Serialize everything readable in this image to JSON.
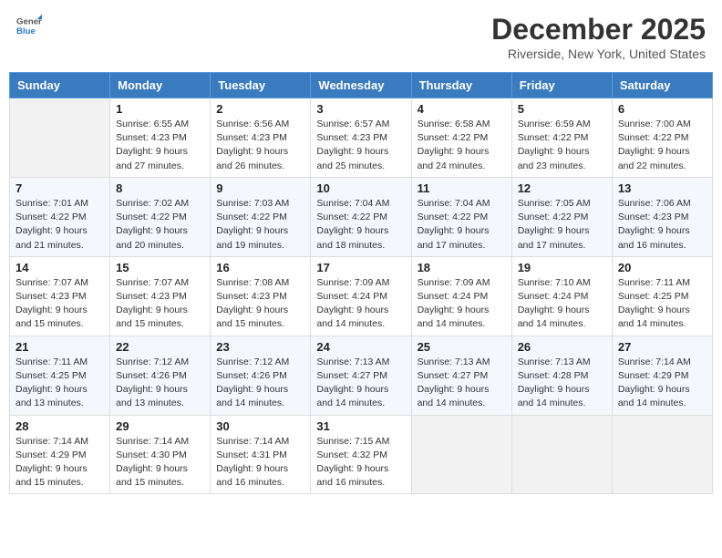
{
  "header": {
    "logo_general": "General",
    "logo_blue": "Blue",
    "month_title": "December 2025",
    "location": "Riverside, New York, United States"
  },
  "days_of_week": [
    "Sunday",
    "Monday",
    "Tuesday",
    "Wednesday",
    "Thursday",
    "Friday",
    "Saturday"
  ],
  "weeks": [
    [
      {
        "num": "",
        "empty": true
      },
      {
        "num": "1",
        "sunrise": "6:55 AM",
        "sunset": "4:23 PM",
        "daylight": "9 hours and 27 minutes."
      },
      {
        "num": "2",
        "sunrise": "6:56 AM",
        "sunset": "4:23 PM",
        "daylight": "9 hours and 26 minutes."
      },
      {
        "num": "3",
        "sunrise": "6:57 AM",
        "sunset": "4:23 PM",
        "daylight": "9 hours and 25 minutes."
      },
      {
        "num": "4",
        "sunrise": "6:58 AM",
        "sunset": "4:22 PM",
        "daylight": "9 hours and 24 minutes."
      },
      {
        "num": "5",
        "sunrise": "6:59 AM",
        "sunset": "4:22 PM",
        "daylight": "9 hours and 23 minutes."
      },
      {
        "num": "6",
        "sunrise": "7:00 AM",
        "sunset": "4:22 PM",
        "daylight": "9 hours and 22 minutes."
      }
    ],
    [
      {
        "num": "7",
        "sunrise": "7:01 AM",
        "sunset": "4:22 PM",
        "daylight": "9 hours and 21 minutes."
      },
      {
        "num": "8",
        "sunrise": "7:02 AM",
        "sunset": "4:22 PM",
        "daylight": "9 hours and 20 minutes."
      },
      {
        "num": "9",
        "sunrise": "7:03 AM",
        "sunset": "4:22 PM",
        "daylight": "9 hours and 19 minutes."
      },
      {
        "num": "10",
        "sunrise": "7:04 AM",
        "sunset": "4:22 PM",
        "daylight": "9 hours and 18 minutes."
      },
      {
        "num": "11",
        "sunrise": "7:04 AM",
        "sunset": "4:22 PM",
        "daylight": "9 hours and 17 minutes."
      },
      {
        "num": "12",
        "sunrise": "7:05 AM",
        "sunset": "4:22 PM",
        "daylight": "9 hours and 17 minutes."
      },
      {
        "num": "13",
        "sunrise": "7:06 AM",
        "sunset": "4:23 PM",
        "daylight": "9 hours and 16 minutes."
      }
    ],
    [
      {
        "num": "14",
        "sunrise": "7:07 AM",
        "sunset": "4:23 PM",
        "daylight": "9 hours and 15 minutes."
      },
      {
        "num": "15",
        "sunrise": "7:07 AM",
        "sunset": "4:23 PM",
        "daylight": "9 hours and 15 minutes."
      },
      {
        "num": "16",
        "sunrise": "7:08 AM",
        "sunset": "4:23 PM",
        "daylight": "9 hours and 15 minutes."
      },
      {
        "num": "17",
        "sunrise": "7:09 AM",
        "sunset": "4:24 PM",
        "daylight": "9 hours and 14 minutes."
      },
      {
        "num": "18",
        "sunrise": "7:09 AM",
        "sunset": "4:24 PM",
        "daylight": "9 hours and 14 minutes."
      },
      {
        "num": "19",
        "sunrise": "7:10 AM",
        "sunset": "4:24 PM",
        "daylight": "9 hours and 14 minutes."
      },
      {
        "num": "20",
        "sunrise": "7:11 AM",
        "sunset": "4:25 PM",
        "daylight": "9 hours and 14 minutes."
      }
    ],
    [
      {
        "num": "21",
        "sunrise": "7:11 AM",
        "sunset": "4:25 PM",
        "daylight": "9 hours and 13 minutes."
      },
      {
        "num": "22",
        "sunrise": "7:12 AM",
        "sunset": "4:26 PM",
        "daylight": "9 hours and 13 minutes."
      },
      {
        "num": "23",
        "sunrise": "7:12 AM",
        "sunset": "4:26 PM",
        "daylight": "9 hours and 14 minutes."
      },
      {
        "num": "24",
        "sunrise": "7:13 AM",
        "sunset": "4:27 PM",
        "daylight": "9 hours and 14 minutes."
      },
      {
        "num": "25",
        "sunrise": "7:13 AM",
        "sunset": "4:27 PM",
        "daylight": "9 hours and 14 minutes."
      },
      {
        "num": "26",
        "sunrise": "7:13 AM",
        "sunset": "4:28 PM",
        "daylight": "9 hours and 14 minutes."
      },
      {
        "num": "27",
        "sunrise": "7:14 AM",
        "sunset": "4:29 PM",
        "daylight": "9 hours and 14 minutes."
      }
    ],
    [
      {
        "num": "28",
        "sunrise": "7:14 AM",
        "sunset": "4:29 PM",
        "daylight": "9 hours and 15 minutes."
      },
      {
        "num": "29",
        "sunrise": "7:14 AM",
        "sunset": "4:30 PM",
        "daylight": "9 hours and 15 minutes."
      },
      {
        "num": "30",
        "sunrise": "7:14 AM",
        "sunset": "4:31 PM",
        "daylight": "9 hours and 16 minutes."
      },
      {
        "num": "31",
        "sunrise": "7:15 AM",
        "sunset": "4:32 PM",
        "daylight": "9 hours and 16 minutes."
      },
      {
        "num": "",
        "empty": true
      },
      {
        "num": "",
        "empty": true
      },
      {
        "num": "",
        "empty": true
      }
    ]
  ],
  "labels": {
    "sunrise_prefix": "Sunrise: ",
    "sunset_prefix": "Sunset: ",
    "daylight_prefix": "Daylight: "
  }
}
